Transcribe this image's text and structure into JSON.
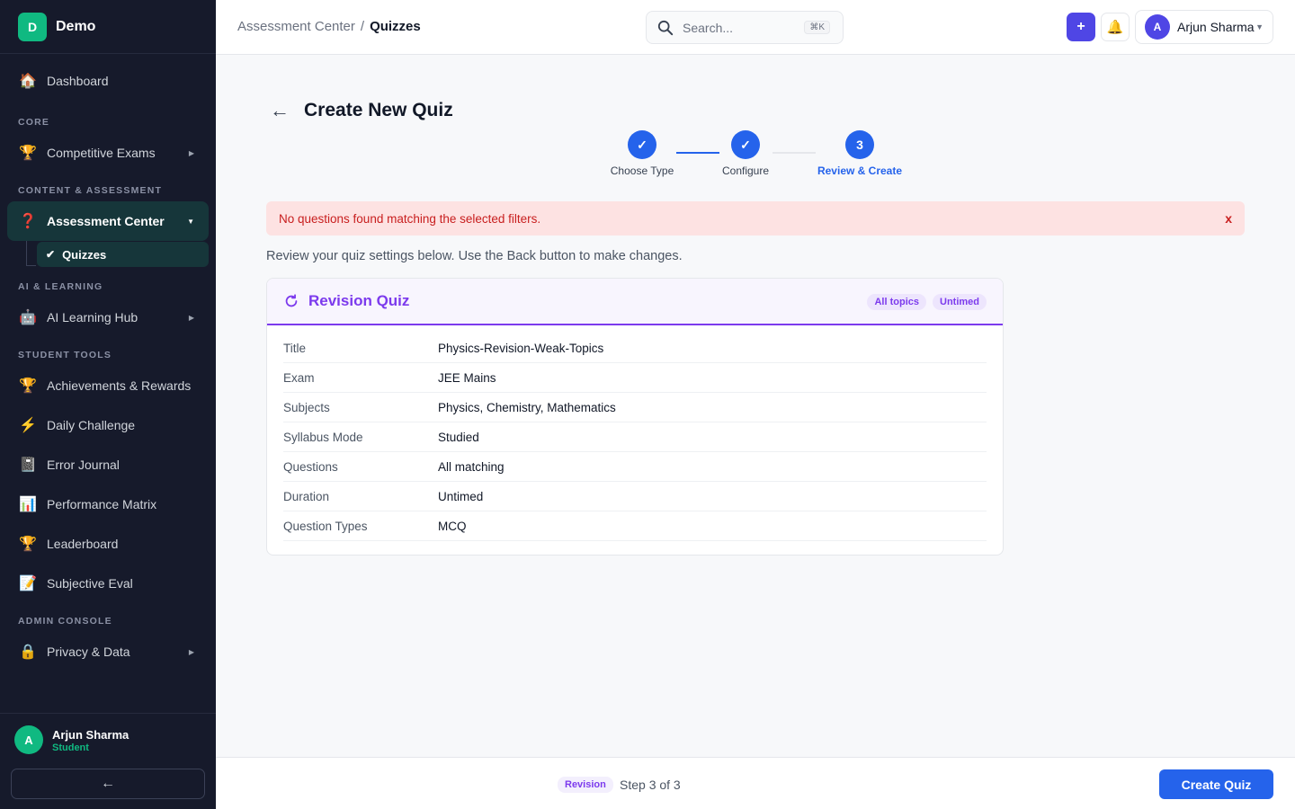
{
  "brand": {
    "logo_letter": "D",
    "name": "Demo"
  },
  "sidebar": {
    "dashboard": {
      "icon": "🏠",
      "label": "Dashboard"
    },
    "sections": {
      "core": "CORE",
      "content": "CONTENT & ASSESSMENT",
      "ai": "AI & LEARNING",
      "student": "STUDENT TOOLS",
      "admin": "ADMIN CONSOLE"
    },
    "competitive_exams": {
      "icon": "🏆",
      "label": "Competitive Exams"
    },
    "assessment_center": {
      "icon": "❓",
      "label": "Assessment Center"
    },
    "quizzes": {
      "label": "Quizzes"
    },
    "ai_hub": {
      "icon": "🤖",
      "label": "AI Learning Hub"
    },
    "achievements": {
      "icon": "🏆",
      "label": "Achievements & Rewards"
    },
    "daily_challenge": {
      "icon": "⚡",
      "label": "Daily Challenge"
    },
    "error_journal": {
      "icon": "📓",
      "label": "Error Journal"
    },
    "performance_matrix": {
      "icon": "📊",
      "label": "Performance Matrix"
    },
    "leaderboard": {
      "icon": "🏆",
      "label": "Leaderboard"
    },
    "subjective_eval": {
      "icon": "📝",
      "label": "Subjective Eval"
    },
    "privacy": {
      "icon": "🔒",
      "label": "Privacy & Data"
    },
    "user": {
      "avatar": "A",
      "name": "Arjun Sharma",
      "role": "Student"
    },
    "collapse_icon": "←"
  },
  "header": {
    "breadcrumb": {
      "parent": "Assessment Center",
      "sep": "/",
      "current": "Quizzes"
    },
    "search": {
      "placeholder": "Search...",
      "shortcut": "⌘K"
    },
    "plus": "+",
    "bell": "🔔",
    "user": {
      "avatar": "A",
      "name": "Arjun Sharma",
      "caret": "▼"
    }
  },
  "page": {
    "back": "←",
    "title": "Create New Quiz",
    "steps": [
      {
        "marker": "✓",
        "label": "Choose Type"
      },
      {
        "marker": "✓",
        "label": "Configure"
      },
      {
        "marker": "3",
        "label": "Review & Create"
      }
    ],
    "alert": {
      "message": "No questions found matching the selected filters.",
      "close": "x"
    },
    "hint": "Review your quiz settings below. Use the Back button to make changes.",
    "card": {
      "title": "Revision Quiz",
      "chips": [
        "All topics",
        "Untimed"
      ],
      "rows": [
        {
          "key": "Title",
          "value": "Physics-Revision-Weak-Topics"
        },
        {
          "key": "Exam",
          "value": "JEE Mains"
        },
        {
          "key": "Subjects",
          "value": "Physics, Chemistry, Mathematics"
        },
        {
          "key": "Syllabus Mode",
          "value": "Studied"
        },
        {
          "key": "Questions",
          "value": "All matching"
        },
        {
          "key": "Duration",
          "value": "Untimed"
        },
        {
          "key": "Question Types",
          "value": "MCQ"
        }
      ]
    }
  },
  "footer": {
    "badge": "Revision",
    "step": "Step 3 of 3",
    "create": "Create Quiz"
  },
  "colors": {
    "primary": "#2563eb",
    "accent": "#7c3aed",
    "indigo": "#4f46e5",
    "green": "#10b981",
    "alert_bg": "#fde2e2",
    "alert_text": "#c81e1e",
    "sidebar_bg": "#161a2b"
  }
}
